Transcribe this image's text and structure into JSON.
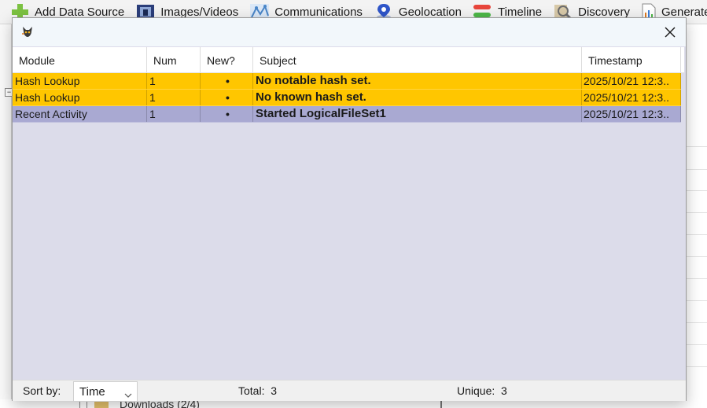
{
  "toolbar": {
    "items": [
      {
        "label": "Add Data Source",
        "icon": "add-icon"
      },
      {
        "label": "Images/Videos",
        "icon": "images-icon"
      },
      {
        "label": "Communications",
        "icon": "communications-icon"
      },
      {
        "label": "Geolocation",
        "icon": "geolocation-icon"
      },
      {
        "label": "Timeline",
        "icon": "timeline-icon"
      },
      {
        "label": "Discovery",
        "icon": "discovery-icon"
      },
      {
        "label": "Generate",
        "icon": "report-icon"
      }
    ]
  },
  "background": {
    "tree_item": "Downloads (2/4)"
  },
  "dialog": {
    "close_glyph": "✕",
    "columns": [
      "Module",
      "Num",
      "New?",
      "Subject",
      "Timestamp"
    ],
    "rows": [
      {
        "module": "Hash Lookup",
        "num": "1",
        "new": "•",
        "subject": "No notable hash set.",
        "timestamp": "2025/10/21 12:3..",
        "color": "#ffc600"
      },
      {
        "module": "Hash Lookup",
        "num": "1",
        "new": "•",
        "subject": "No known hash set.",
        "timestamp": "2025/10/21 12:3..",
        "color": "#ffc600"
      },
      {
        "module": "Recent Activity",
        "num": "1",
        "new": "•",
        "subject": "Started LogicalFileSet1",
        "timestamp": "2025/10/21 12:3..",
        "color": "#a9a9d2"
      }
    ],
    "status": {
      "sort_label": "Sort by:",
      "sort_value": "Time",
      "total_label": "Total:",
      "total_value": "3",
      "unique_label": "Unique:",
      "unique_value": "3"
    }
  }
}
